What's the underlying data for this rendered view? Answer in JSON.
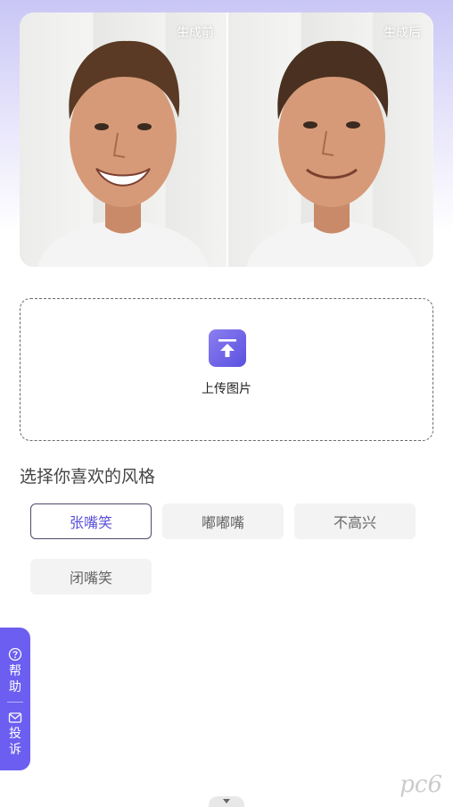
{
  "compare": {
    "before_label": "生成前",
    "after_label": "生成后"
  },
  "upload": {
    "label": "上传图片",
    "icon": "upload-icon"
  },
  "styles": {
    "title": "选择你喜欢的风格",
    "options": [
      "张嘴笑",
      "嘟嘟嘴",
      "不高兴",
      "闭嘴笑"
    ],
    "selected": "张嘴笑"
  },
  "side_tab": {
    "help_label": "帮助",
    "complaint_label": "投诉",
    "accent": "#6b5ef0"
  },
  "watermark": "pc6"
}
